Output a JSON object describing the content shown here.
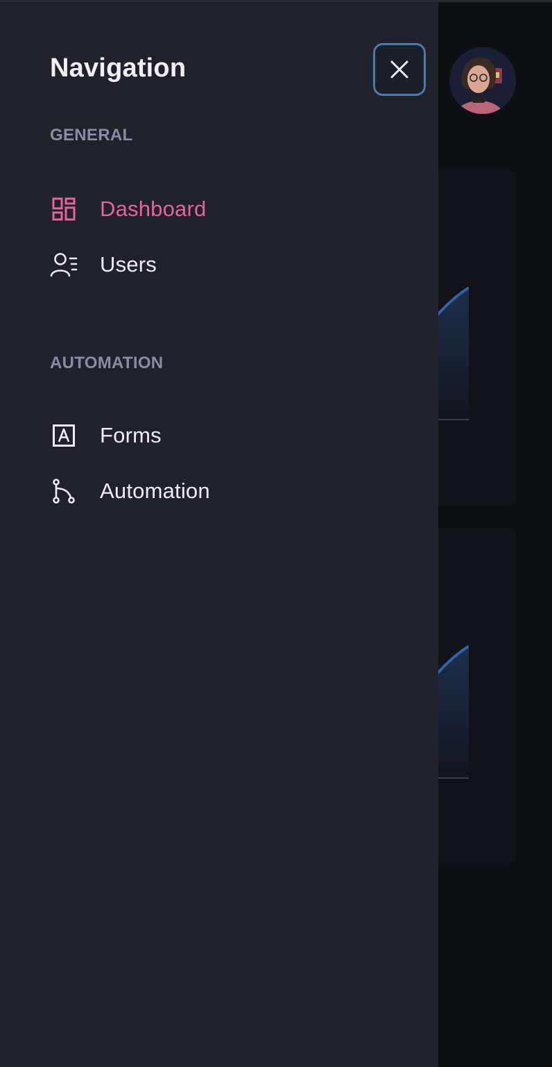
{
  "drawer": {
    "title": "Navigation",
    "close_icon": "close-icon"
  },
  "sections": [
    {
      "label": "GENERAL",
      "items": [
        {
          "label": "Dashboard",
          "icon": "dashboard-icon",
          "active": true
        },
        {
          "label": "Users",
          "icon": "users-list-icon",
          "active": false
        }
      ]
    },
    {
      "label": "AUTOMATION",
      "items": [
        {
          "label": "Forms",
          "icon": "form-letter-icon",
          "active": false
        },
        {
          "label": "Automation",
          "icon": "branch-icon",
          "active": false
        }
      ]
    }
  ],
  "colors": {
    "drawer_bg": "#20212b",
    "accent": "#e0669a",
    "section_label": "#8a8ca3",
    "focus_ring": "#4a7bb0"
  }
}
